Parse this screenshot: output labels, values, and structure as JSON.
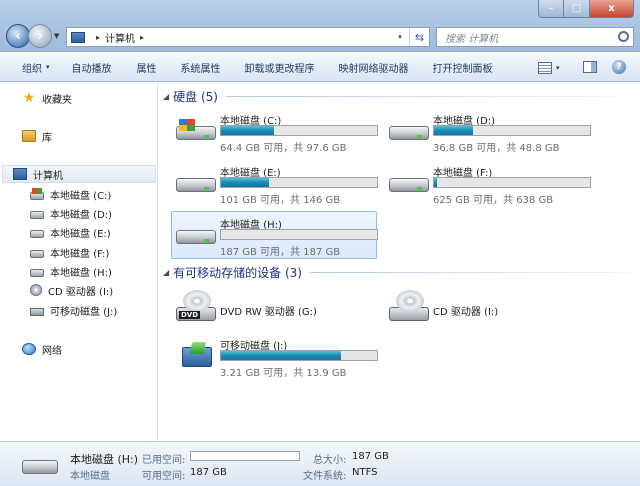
{
  "window": {
    "min_glyph": "–",
    "max_glyph": "□",
    "close_glyph": "x"
  },
  "address": {
    "root": "计算机",
    "sep1": "▸",
    "sep2": "▸",
    "refresh_glyph": "⇆",
    "drop_glyph": "▾"
  },
  "search": {
    "placeholder": "搜索 计算机"
  },
  "toolbar": {
    "organize": "组织",
    "autoplay": "自动播放",
    "properties": "属性",
    "system_properties": "系统属性",
    "uninstall": "卸载或更改程序",
    "map_drive": "映射网络驱动器",
    "control_panel": "打开控制面板",
    "arrow": "▾",
    "help_glyph": "?"
  },
  "sidebar": {
    "favorites": "收藏夹",
    "libraries": "库",
    "computer": "计算机",
    "drives": [
      "本地磁盘 (C:)",
      "本地磁盘 (D:)",
      "本地磁盘 (E:)",
      "本地磁盘 (F:)",
      "本地磁盘 (H:)",
      "CD 驱动器 (I:)",
      "可移动磁盘 (J:)"
    ],
    "network": "网络"
  },
  "groups": {
    "hard_drives": "硬盘 (5)",
    "removable": "有可移动存储的设备 (3)",
    "tri": "◢"
  },
  "hard_drives": [
    {
      "name": "本地磁盘 (C:)",
      "info": "64.4 GB 可用，共 97.6 GB",
      "used_fraction": 0.34
    },
    {
      "name": "本地磁盘 (D:)",
      "info": "36.8 GB 可用，共 48.8 GB",
      "used_fraction": 0.25
    },
    {
      "name": "本地磁盘 (E:)",
      "info": "101 GB 可用，共 146 GB",
      "used_fraction": 0.31
    },
    {
      "name": "本地磁盘 (F:)",
      "info": "625 GB 可用，共 638 GB",
      "used_fraction": 0.02
    },
    {
      "name": "本地磁盘 (H:)",
      "info": "187 GB 可用，共 187 GB",
      "used_fraction": 0.0
    }
  ],
  "removable": [
    {
      "name": "DVD RW 驱动器 (G:)"
    },
    {
      "name": "CD 驱动器 (I:)"
    },
    {
      "name": "可移动磁盘 (J:)",
      "info": "3.21 GB 可用，共 13.9 GB",
      "used_fraction": 0.77
    }
  ],
  "icon_text": {
    "dvd": "DVD"
  },
  "details": {
    "name": "本地磁盘 (H:)",
    "type": "本地磁盘",
    "used_label": "已用空间:",
    "free_label": "可用空间:",
    "free_value": "187 GB",
    "total_label": "总大小:",
    "total_value": "187 GB",
    "fs_label": "文件系统:",
    "fs_value": "NTFS",
    "used_fraction": 0.0
  }
}
